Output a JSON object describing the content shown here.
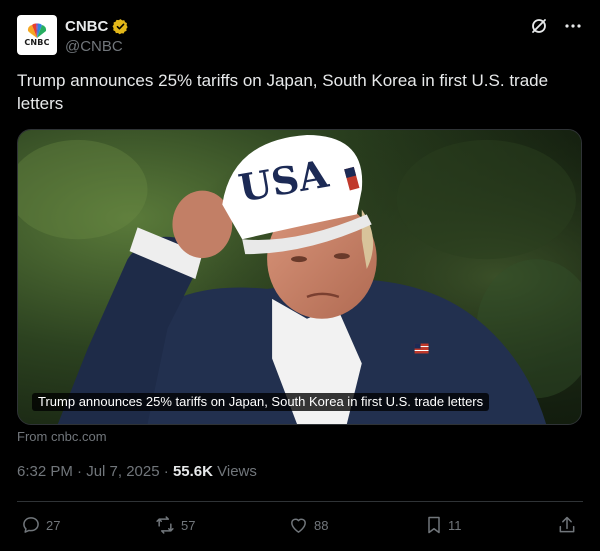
{
  "account": {
    "display_name": "CNBC",
    "handle": "@CNBC",
    "avatar_text": "CNBC",
    "verified_badge_color": "#e2b719"
  },
  "tweet": {
    "text": "Trump announces 25% tariffs on Japan, South Korea in first U.S. trade letters",
    "media_caption": "Trump announces 25% tariffs on Japan, South Korea in first U.S. trade letters",
    "media_hat_text": "USA",
    "source": "From cnbc.com",
    "time": "6:32 PM · Jul 7, 2025",
    "separator": "·",
    "views_count": "55.6K",
    "views_label": "Views"
  },
  "actions": {
    "replies": "27",
    "reposts": "57",
    "likes": "88",
    "bookmarks": "11"
  },
  "icons": {
    "header": [
      "grok-icon",
      "more-icon"
    ],
    "actions": [
      "reply-icon",
      "repost-icon",
      "like-icon",
      "bookmark-icon",
      "share-icon"
    ]
  },
  "colors": {
    "background": "#000000",
    "text_primary": "#e7e9ea",
    "text_secondary": "#71767b",
    "divider": "#2f3336"
  }
}
